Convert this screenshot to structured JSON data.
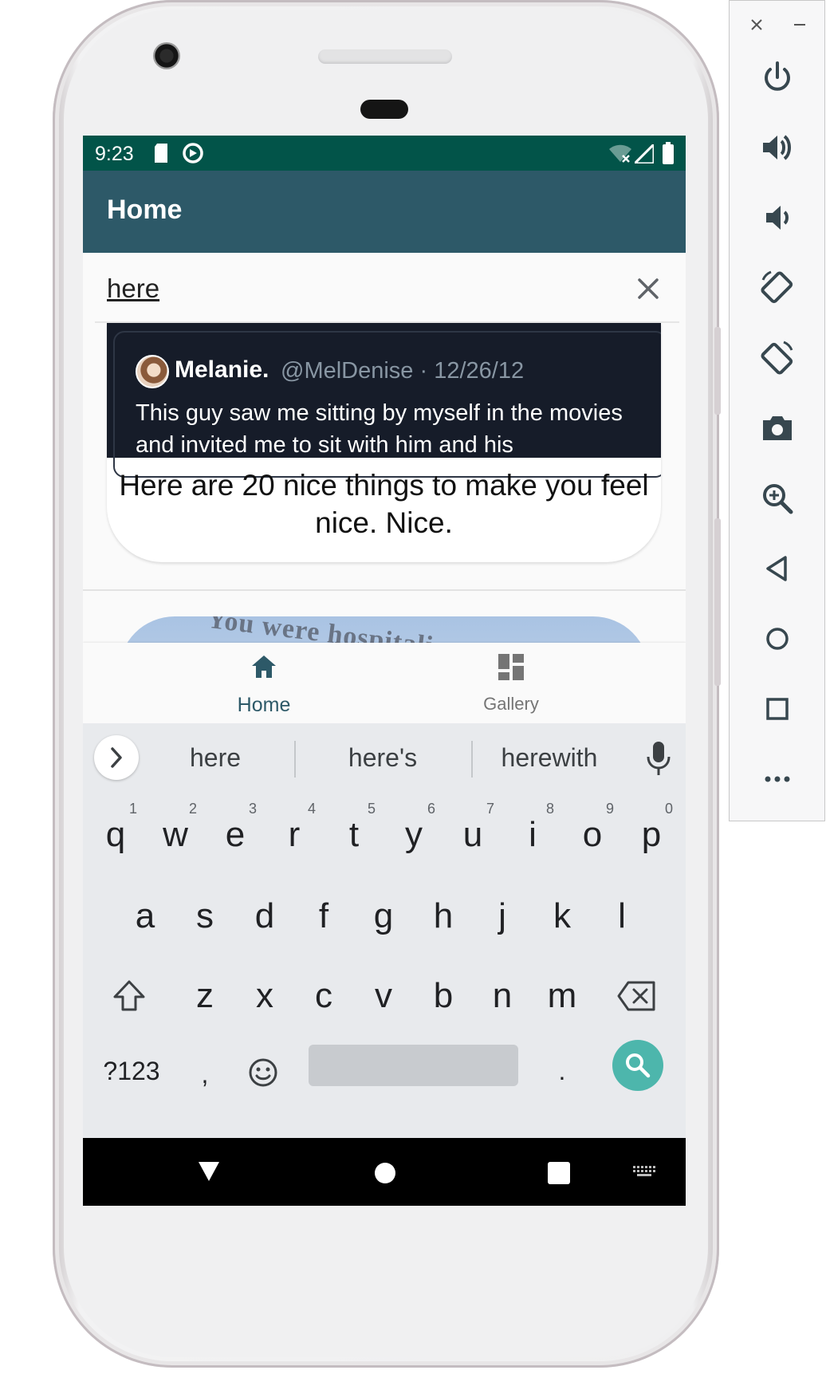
{
  "status_bar": {
    "time": "9:23"
  },
  "app_bar": {
    "title": "Home"
  },
  "search": {
    "value": "here"
  },
  "feed": {
    "card1": {
      "tweet_name": "Melanie.",
      "tweet_handle": "@MelDenise · 12/26/12",
      "tweet_text": "This guy saw me sitting by myself in the movies and invited me to sit with him and his",
      "caption": "Here are 20 nice things to make you feel nice. Nice."
    },
    "card2": {
      "image_text": "You were hospitali"
    }
  },
  "bottom_nav": {
    "items": [
      {
        "label": "Home",
        "icon": "home-icon",
        "active": true
      },
      {
        "label": "Gallery",
        "icon": "dashboard-icon",
        "active": false
      }
    ]
  },
  "keyboard": {
    "suggestions": [
      "here",
      "here's",
      "herewith"
    ],
    "row1": [
      "q",
      "w",
      "e",
      "r",
      "t",
      "y",
      "u",
      "i",
      "o",
      "p"
    ],
    "row1_hints": [
      "1",
      "2",
      "3",
      "4",
      "5",
      "6",
      "7",
      "8",
      "9",
      "0"
    ],
    "row2": [
      "a",
      "s",
      "d",
      "f",
      "g",
      "h",
      "j",
      "k",
      "l"
    ],
    "row3": [
      "z",
      "x",
      "c",
      "v",
      "b",
      "n",
      "m"
    ],
    "symbols_key": "?123",
    "comma_key": ",",
    "period_key": ".",
    "accent_color": "#4db6ac"
  },
  "colors": {
    "status_bar": "#025449",
    "app_bar": "#2d5968",
    "nav_active": "#2d5968",
    "nav_inactive": "#757575"
  },
  "emulator_toolbar": {
    "items": [
      "close-icon",
      "minimize-icon",
      "power-icon",
      "volume-up-icon",
      "volume-down-icon",
      "rotate-left-icon",
      "rotate-right-icon",
      "camera-icon",
      "zoom-icon",
      "back-icon",
      "home-icon",
      "overview-icon",
      "more-icon"
    ]
  }
}
